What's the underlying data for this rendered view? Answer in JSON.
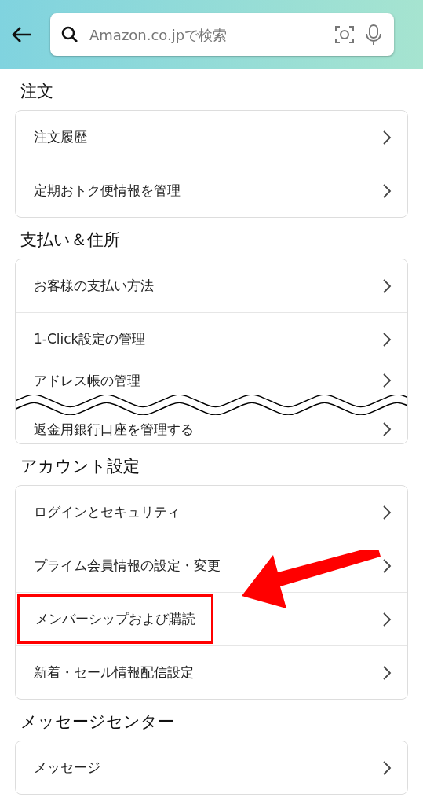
{
  "search": {
    "placeholder": "Amazon.co.jpで検索"
  },
  "sections": [
    {
      "title": "注文",
      "torn": false,
      "items": [
        {
          "label": "注文履歴",
          "highlighted": false
        },
        {
          "label": "定期おトク便情報を管理",
          "highlighted": false
        }
      ]
    },
    {
      "title": "支払い＆住所",
      "torn": true,
      "items": [
        {
          "label": "お客様の支払い方法",
          "highlighted": false
        },
        {
          "label": "1-Click設定の管理",
          "highlighted": false
        },
        {
          "label": "アドレス帳の管理",
          "highlighted": false
        },
        {
          "label": "返金用銀行口座を管理する",
          "highlighted": false
        }
      ]
    },
    {
      "title": "アカウント設定",
      "torn": false,
      "items": [
        {
          "label": "ログインとセキュリティ",
          "highlighted": false
        },
        {
          "label": "プライム会員情報の設定・変更",
          "highlighted": false
        },
        {
          "label": "メンバーシップおよび購読",
          "highlighted": true
        },
        {
          "label": "新着・セール情報配信設定",
          "highlighted": false
        }
      ]
    },
    {
      "title": "メッセージセンター",
      "torn": false,
      "items": [
        {
          "label": "メッセージ",
          "highlighted": false
        }
      ]
    }
  ]
}
